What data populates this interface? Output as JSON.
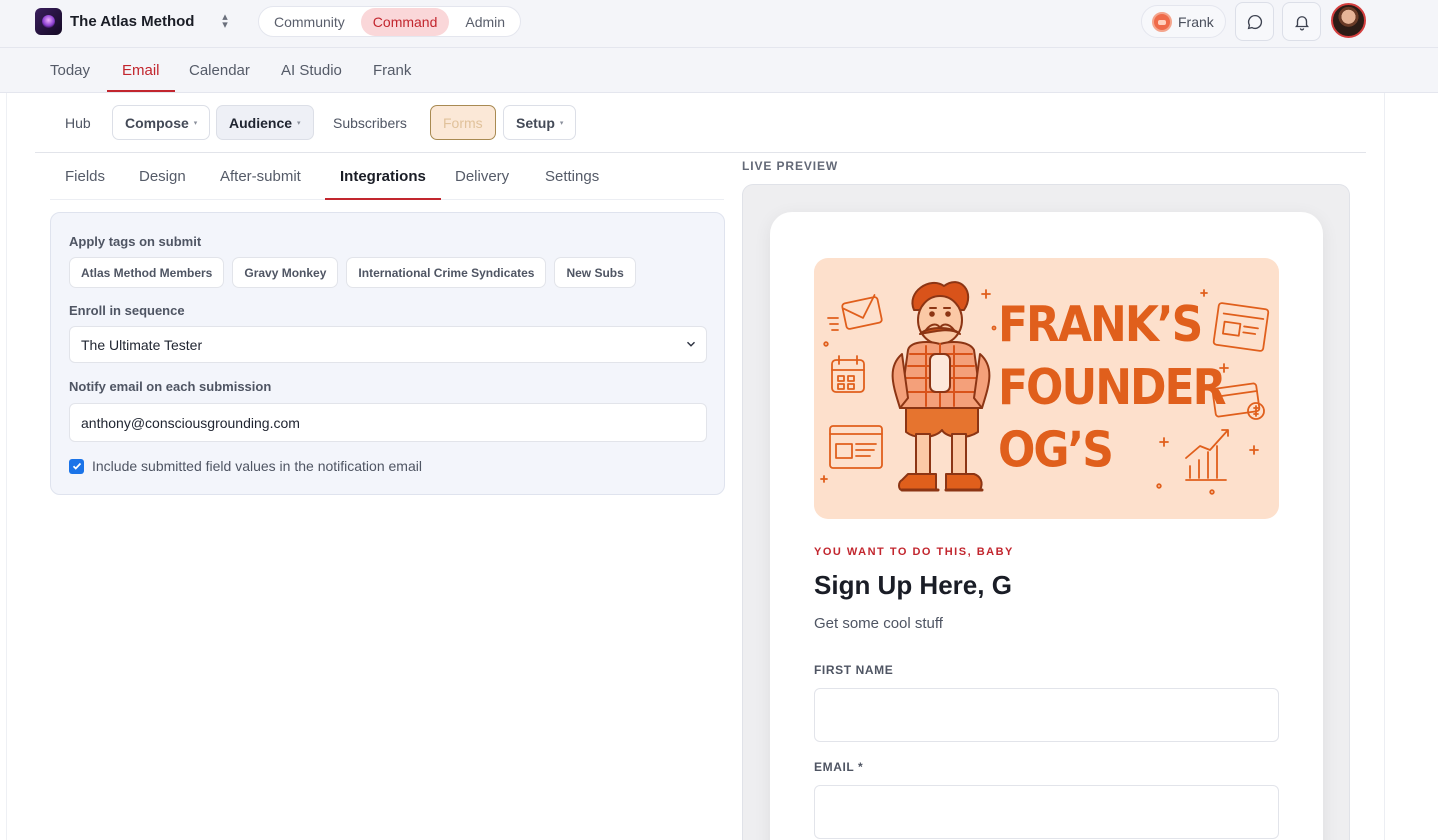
{
  "app": {
    "brand": "The Atlas Method",
    "modes": [
      "Community",
      "Command",
      "Admin"
    ],
    "active_mode": "Command",
    "user_name": "Frank"
  },
  "icons": {
    "switcher": "chevron-up-down-icon",
    "chat": "chat-bubble-icon",
    "notifications": "bell-icon",
    "select": "chevron-down-icon",
    "check": "checkmark-icon"
  },
  "colors": {
    "accent": "#c2262e",
    "checkbox": "#1a73e8",
    "hero_background": "#fde0cc",
    "hero_ink": "#e05f1c"
  },
  "nav": {
    "items": [
      "Today",
      "Email",
      "Calendar",
      "AI Studio",
      "Frank"
    ],
    "active": "Email"
  },
  "subnav": {
    "hub": "Hub",
    "compose": "Compose",
    "audience": "Audience",
    "subscribers": "Subscribers",
    "forms": "Forms",
    "setup": "Setup",
    "caret": "▾"
  },
  "tabs": {
    "items": [
      "Fields",
      "Design",
      "After-submit",
      "Integrations",
      "Delivery",
      "Settings"
    ],
    "active": "Integrations"
  },
  "integrations": {
    "tags_label": "Apply tags on submit",
    "tags": [
      "Atlas Method Members",
      "Gravy Monkey",
      "International Crime Syndicates",
      "New Subs"
    ],
    "sequence_label": "Enroll in sequence",
    "sequence_value": "The Ultimate Tester",
    "notify_label": "Notify email on each submission",
    "notify_email": "anthony@consciousgrounding.com",
    "include_values_label": "Include submitted field values in the notification email",
    "include_values_checked": true
  },
  "preview": {
    "label": "LIVE PREVIEW",
    "hero_lines": [
      "FRANK’S",
      "FOUNDER",
      "OG’S"
    ],
    "eyebrow": "YOU WANT TO DO THIS, BABY",
    "title": "Sign Up Here, G",
    "subtitle": "Get some cool stuff",
    "fields": [
      {
        "label": "FIRST NAME",
        "value": ""
      },
      {
        "label": "EMAIL *",
        "value": ""
      }
    ]
  }
}
